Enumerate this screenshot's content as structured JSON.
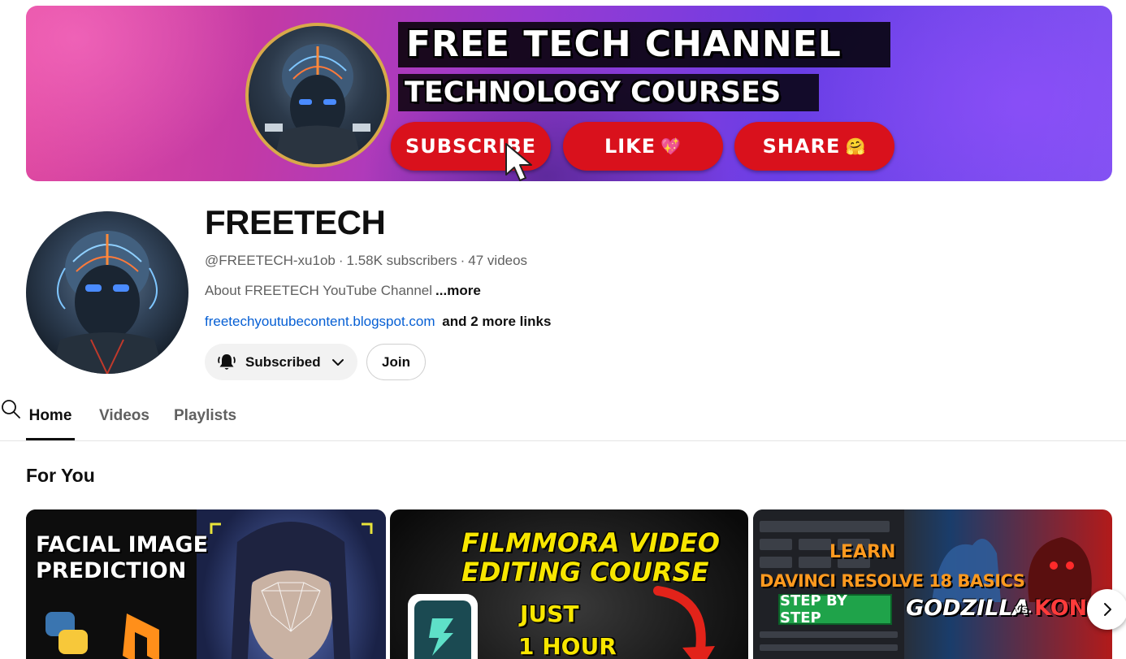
{
  "banner": {
    "title": "FREE TECH CHANNEL",
    "subtitle": "TECHNOLOGY COURSES",
    "subscribe_label": "SUBSCRIBE",
    "like_label": "LIKE",
    "like_emoji": "💖",
    "share_label": "SHARE",
    "share_emoji": "🤗",
    "accent_color": "#d9111c"
  },
  "channel": {
    "name": "FREETECH",
    "handle": "@FREETECH-xu1ob",
    "subscribers": "1.58K subscribers",
    "videos": "47 videos",
    "separator": "·",
    "about": "About FREETECH YouTube Channel",
    "about_more": "...more",
    "link": "freetechyoutubecontent.blogspot.com",
    "more_links": "and 2 more links",
    "subscribed_label": "Subscribed",
    "join_label": "Join",
    "link_color": "#065fd4"
  },
  "tabs": [
    {
      "label": "Home",
      "active": true
    },
    {
      "label": "Videos",
      "active": false
    },
    {
      "label": "Playlists",
      "active": false
    }
  ],
  "section": {
    "title": "For You"
  },
  "videos": [
    {
      "line1": "FACIAL IMAGE",
      "line2": "PREDICTION"
    },
    {
      "line1": "FILMMORA VIDEO",
      "line2": "EDITING COURSE",
      "line3": "JUST",
      "line4": "1 HOUR"
    },
    {
      "line1": "LEARN",
      "line2": "DAVINCI RESOLVE 18 BASICS",
      "badge": "STEP BY STEP",
      "line3": "GODZILLA",
      "line4": "vs.",
      "line5": "KONG"
    }
  ],
  "icons": {
    "bell": "bell-ring-icon",
    "chevron": "chevron-down-icon",
    "search": "search-icon",
    "next": "chevron-right-icon",
    "cursor": "mouse-pointer-icon"
  }
}
